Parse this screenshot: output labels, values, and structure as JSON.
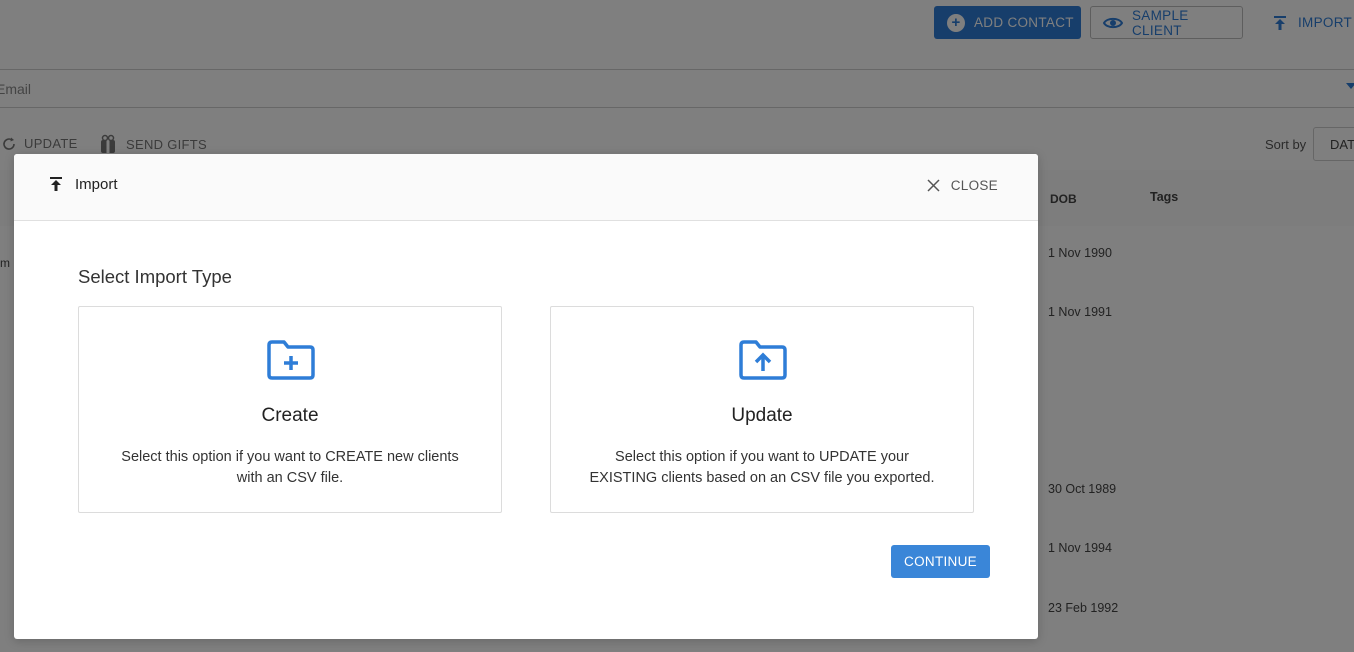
{
  "colors": {
    "accent": "#2e7dd7",
    "overlay": "rgba(0,0,0,0.5)"
  },
  "background": {
    "header": {
      "add_contact_label": "ADD CONTACT",
      "add_contact_icon": "plus-circle-icon",
      "sample_client_label": "SAMPLE CLIENT",
      "sample_client_icon": "eye-icon",
      "import_label": "IMPORT",
      "import_icon": "upload-arrow-icon"
    },
    "filter": {
      "email_placeholder": "Email"
    },
    "actions": {
      "update_label": "UPDATE",
      "update_icon": "refresh-icon",
      "send_gifts_label": "SEND GIFTS",
      "send_gifts_icon": "gift-icon",
      "sort_by_label": "Sort by",
      "sort_value": "DAT"
    },
    "table": {
      "columns": {
        "dob": "DOB",
        "tags": "Tags"
      },
      "row_fragment": "m",
      "dob_values": [
        "1 Nov 1990",
        "1 Nov 1991",
        "30 Oct 1989",
        "1 Nov 1994",
        "23 Feb 1992"
      ]
    }
  },
  "modal": {
    "title": "Import",
    "title_icon": "upload-arrow-icon",
    "close_label": "CLOSE",
    "close_icon": "close-icon",
    "section_title": "Select Import Type",
    "options": [
      {
        "title": "Create",
        "icon": "folder-plus-icon",
        "description": "Select this option if you want to CREATE new clients with an CSV file."
      },
      {
        "title": "Update",
        "icon": "folder-upload-icon",
        "description": "Select this option if you want to UPDATE your EXISTING clients based on an CSV file you exported."
      }
    ],
    "continue_label": "CONTINUE"
  }
}
